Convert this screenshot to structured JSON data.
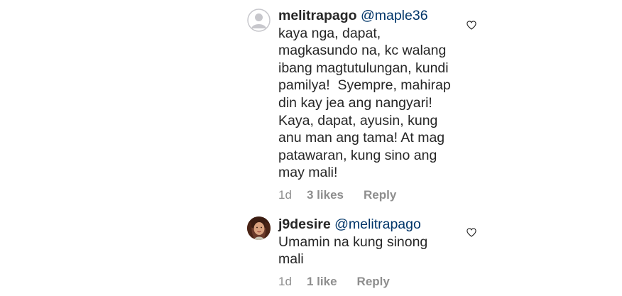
{
  "comments": [
    {
      "username": "melitrapago",
      "mention": "@maple36",
      "lines": [
        "kaya nga, dapat,",
        "magkasundo na, kc walang",
        "ibang magtutulungan, kundi",
        "pamilya!  Syempre, mahirap",
        "din kay jea ang nangyari!",
        "Kaya, dapat, ayusin, kung",
        "anu man ang tama! At mag",
        "patawaran, kung sino ang",
        "may mali!"
      ],
      "time": "1d",
      "likes": "3 likes",
      "reply": "Reply",
      "like_icon": "heart-outline-icon",
      "avatar": "default-avatar"
    },
    {
      "username": "j9desire",
      "mention": "@melitrapago",
      "lines": [
        "Umamin na kung sinong",
        "mali"
      ],
      "time": "1d",
      "likes": "1 like",
      "reply": "Reply",
      "like_icon": "heart-outline-icon",
      "avatar": "photo-avatar"
    }
  ]
}
